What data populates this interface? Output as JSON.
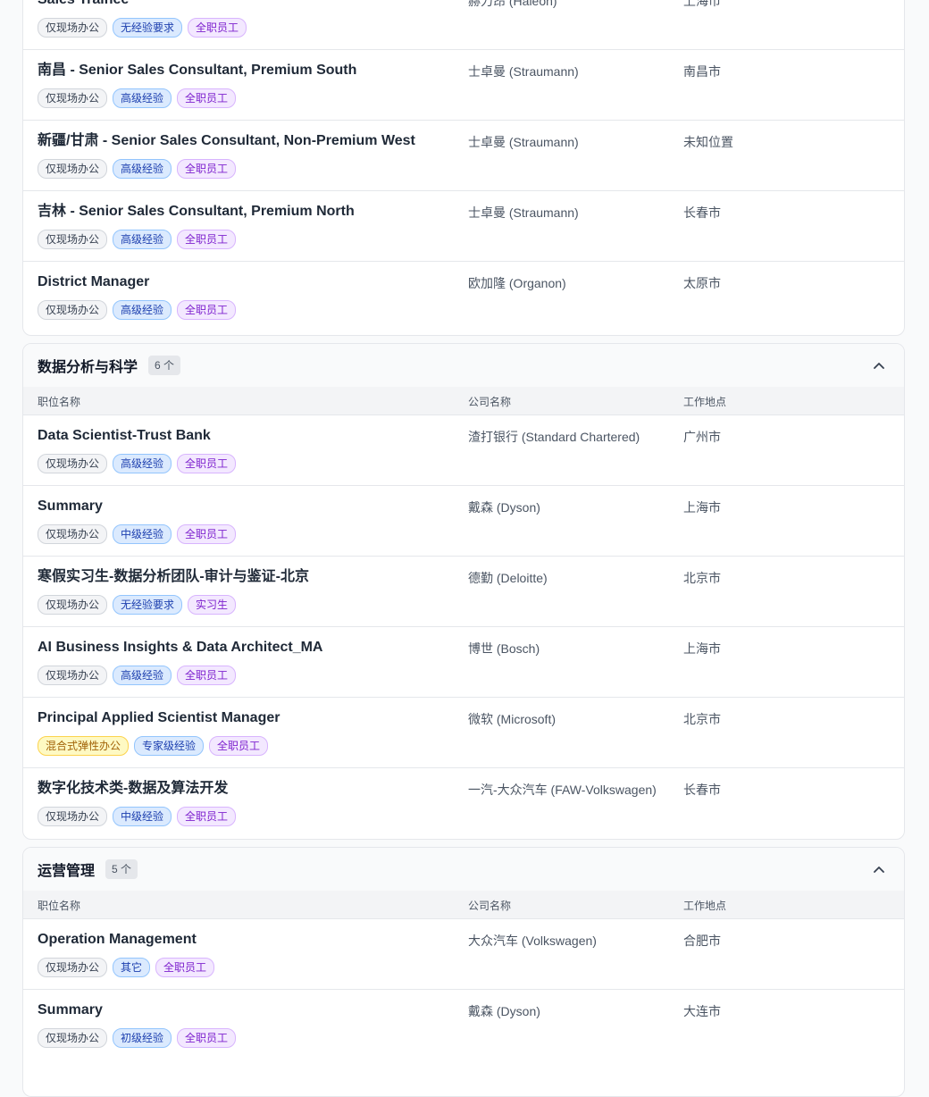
{
  "headers": {
    "title": "职位名称",
    "company": "公司名称",
    "location": "工作地点"
  },
  "sections": [
    {
      "rows": [
        {
          "title": "Sales Trainee",
          "company": "赫力昂 (Haleon)",
          "location": "上海市",
          "tags": [
            {
              "text": "仅现场办公",
              "color": "gray"
            },
            {
              "text": "无经验要求",
              "color": "blue"
            },
            {
              "text": "全职员工",
              "color": "purple"
            }
          ]
        },
        {
          "title": "南昌 - Senior Sales Consultant, Premium South",
          "company": "士卓曼 (Straumann)",
          "location": "南昌市",
          "tags": [
            {
              "text": "仅现场办公",
              "color": "gray"
            },
            {
              "text": "高级经验",
              "color": "blue"
            },
            {
              "text": "全职员工",
              "color": "purple"
            }
          ]
        },
        {
          "title": "新疆/甘肃 - Senior Sales Consultant, Non-Premium West",
          "company": "士卓曼 (Straumann)",
          "location": "未知位置",
          "tags": [
            {
              "text": "仅现场办公",
              "color": "gray"
            },
            {
              "text": "高级经验",
              "color": "blue"
            },
            {
              "text": "全职员工",
              "color": "purple"
            }
          ]
        },
        {
          "title": "吉林 - Senior Sales Consultant, Premium North",
          "company": "士卓曼 (Straumann)",
          "location": "长春市",
          "tags": [
            {
              "text": "仅现场办公",
              "color": "gray"
            },
            {
              "text": "高级经验",
              "color": "blue"
            },
            {
              "text": "全职员工",
              "color": "purple"
            }
          ]
        },
        {
          "title": "District Manager",
          "company": "欧加隆 (Organon)",
          "location": "太原市",
          "tags": [
            {
              "text": "仅现场办公",
              "color": "gray"
            },
            {
              "text": "高级经验",
              "color": "blue"
            },
            {
              "text": "全职员工",
              "color": "purple"
            }
          ]
        }
      ]
    },
    {
      "name": "数据分析与科学",
      "count": "6 个",
      "rows": [
        {
          "title": "Data Scientist-Trust Bank",
          "company": "渣打银行 (Standard Chartered)",
          "location": "广州市",
          "tags": [
            {
              "text": "仅现场办公",
              "color": "gray"
            },
            {
              "text": "高级经验",
              "color": "blue"
            },
            {
              "text": "全职员工",
              "color": "purple"
            }
          ]
        },
        {
          "title": "Summary",
          "company": "戴森 (Dyson)",
          "location": "上海市",
          "tags": [
            {
              "text": "仅现场办公",
              "color": "gray"
            },
            {
              "text": "中级经验",
              "color": "blue"
            },
            {
              "text": "全职员工",
              "color": "purple"
            }
          ]
        },
        {
          "title": "寒假实习生-数据分析团队-审计与鉴证-北京",
          "company": "德勤 (Deloitte)",
          "location": "北京市",
          "tags": [
            {
              "text": "仅现场办公",
              "color": "gray"
            },
            {
              "text": "无经验要求",
              "color": "blue"
            },
            {
              "text": "实习生",
              "color": "purple"
            }
          ]
        },
        {
          "title": "AI Business Insights & Data Architect_MA",
          "company": "博世 (Bosch)",
          "location": "上海市",
          "tags": [
            {
              "text": "仅现场办公",
              "color": "gray"
            },
            {
              "text": "高级经验",
              "color": "blue"
            },
            {
              "text": "全职员工",
              "color": "purple"
            }
          ]
        },
        {
          "title": "Principal Applied Scientist Manager",
          "company": "微软 (Microsoft)",
          "location": "北京市",
          "tags": [
            {
              "text": "混合式弹性办公",
              "color": "yellow"
            },
            {
              "text": "专家级经验",
              "color": "blue"
            },
            {
              "text": "全职员工",
              "color": "purple"
            }
          ]
        },
        {
          "title": "数字化技术类-数据及算法开发",
          "company": "一汽-大众汽车 (FAW-Volkswagen)",
          "location": "长春市",
          "tags": [
            {
              "text": "仅现场办公",
              "color": "gray"
            },
            {
              "text": "中级经验",
              "color": "blue"
            },
            {
              "text": "全职员工",
              "color": "purple"
            }
          ]
        }
      ]
    },
    {
      "name": "运营管理",
      "count": "5 个",
      "rows": [
        {
          "title": "Operation Management",
          "company": "大众汽车 (Volkswagen)",
          "location": "合肥市",
          "tags": [
            {
              "text": "仅现场办公",
              "color": "gray"
            },
            {
              "text": "其它",
              "color": "blue"
            },
            {
              "text": "全职员工",
              "color": "purple"
            }
          ]
        },
        {
          "title": "Summary",
          "company": "戴森 (Dyson)",
          "location": "大连市",
          "tags": [
            {
              "text": "仅现场办公",
              "color": "gray"
            },
            {
              "text": "初级经验",
              "color": "blue"
            },
            {
              "text": "全职员工",
              "color": "purple"
            }
          ]
        }
      ]
    }
  ]
}
